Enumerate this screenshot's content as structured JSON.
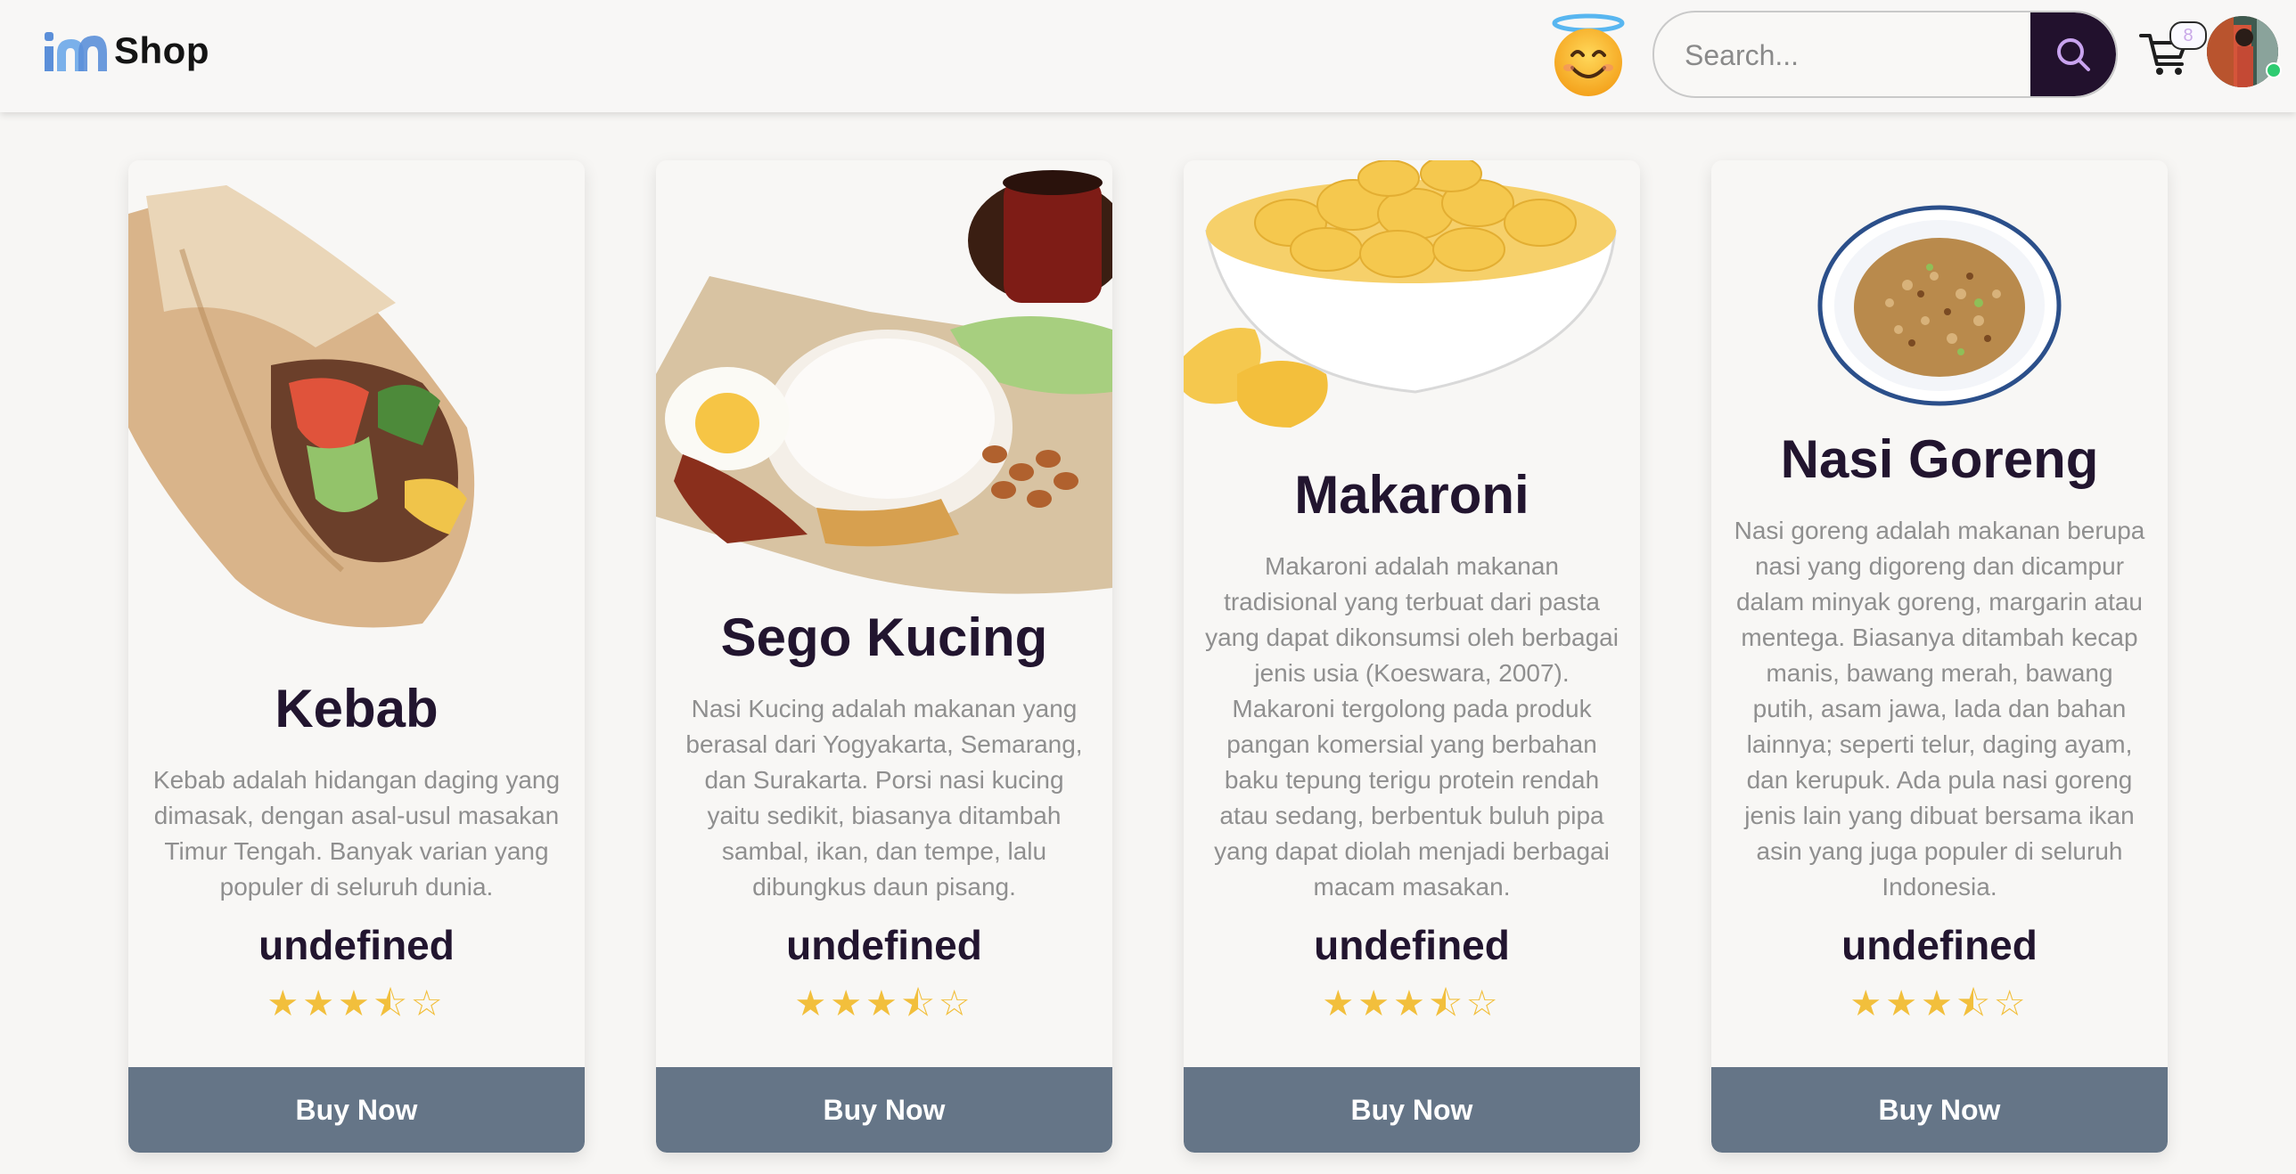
{
  "header": {
    "logo_text": "Shop",
    "search_placeholder": "Search...",
    "cart_count": "8"
  },
  "colors": {
    "background": "#f7f6f4",
    "dark_accent": "#22112d",
    "button": "#657587",
    "star": "#f2bf3c",
    "title": "#22152f",
    "desc": "#8f8f8f"
  },
  "products": [
    {
      "title": "Kebab",
      "description": "Kebab adalah hidangan daging yang dimasak, dengan asal-usul masakan Timur Tengah. Banyak varian yang populer di seluruh dunia.",
      "price": "undefined",
      "stars": "★★★⯪☆",
      "rating": 3.5,
      "button": "Buy Now",
      "image": "kebab-wrap"
    },
    {
      "title": "Sego Kucing",
      "description": "Nasi Kucing adalah makanan yang berasal dari Yogyakarta, Semarang, dan Surakarta. Porsi nasi kucing yaitu sedikit, biasanya ditambah sambal, ikan, dan tempe, lalu dibungkus daun pisang.",
      "price": "undefined",
      "stars": "★★★⯪☆",
      "rating": 3.5,
      "button": "Buy Now",
      "image": "nasi-lemak-plate"
    },
    {
      "title": "Makaroni",
      "description": "Makaroni adalah makanan tradisional yang terbuat dari pasta yang dapat dikonsumsi oleh berbagai jenis usia (Koeswara, 2007). Makaroni tergolong pada produk pangan komersial yang berbahan baku tepung terigu protein rendah atau sedang, berbentuk buluh pipa yang dapat diolah menjadi berbagai macam masakan.",
      "price": "undefined",
      "stars": "★★★⯪☆",
      "rating": 3.5,
      "button": "Buy Now",
      "image": "mac-and-cheese-bowl"
    },
    {
      "title": "Nasi Goreng",
      "description": "Nasi goreng adalah makanan berupa nasi yang digoreng dan dicampur dalam minyak goreng, margarin atau mentega. Biasanya ditambah kecap manis, bawang merah, bawang putih, asam jawa, lada dan bahan lainnya; seperti telur, daging ayam, dan kerupuk. Ada pula nasi goreng jenis lain yang dibuat bersama ikan asin yang juga populer di seluruh Indonesia.",
      "price": "undefined",
      "stars": "★★★⯪☆",
      "rating": 3.5,
      "button": "Buy Now",
      "image": "fried-rice-bowl"
    }
  ]
}
